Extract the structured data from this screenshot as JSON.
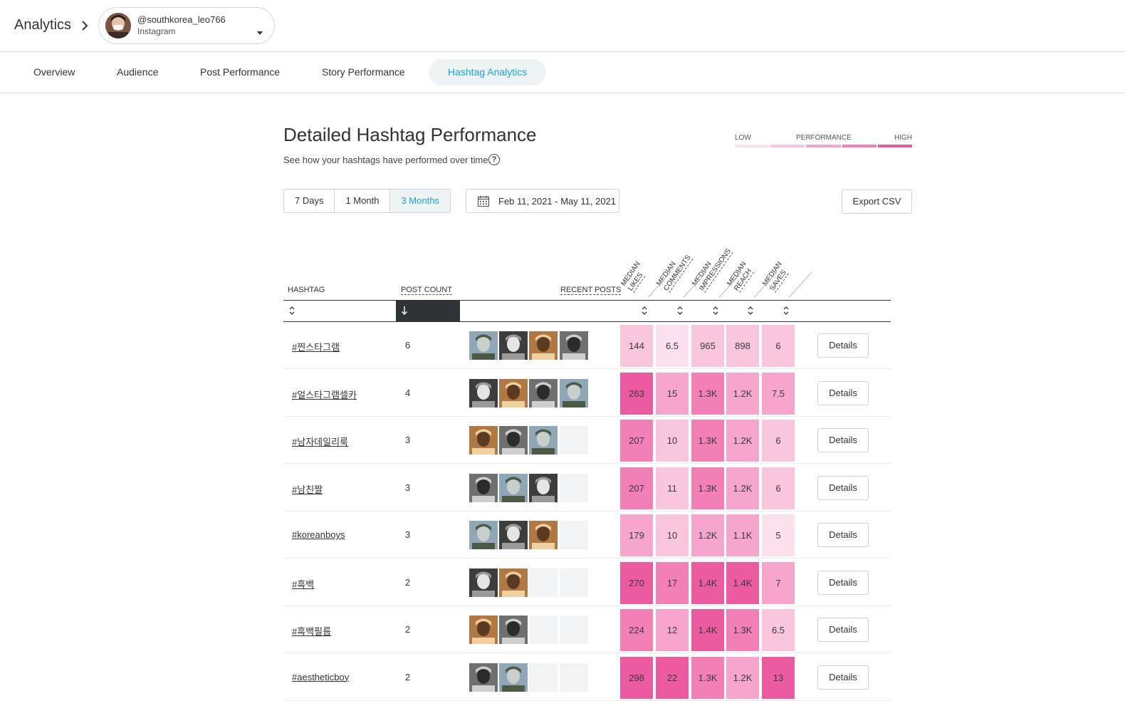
{
  "header": {
    "app_title": "Analytics",
    "account": {
      "handle": "@southkorea_leo766",
      "network": "Instagram"
    }
  },
  "tabs": [
    {
      "label": "Overview",
      "active": false
    },
    {
      "label": "Audience",
      "active": false
    },
    {
      "label": "Post Performance",
      "active": false
    },
    {
      "label": "Story Performance",
      "active": false
    },
    {
      "label": "Hashtag Analytics",
      "active": true
    }
  ],
  "section": {
    "title": "Detailed Hashtag Performance",
    "subtitle": "See how your hashtags have performed over time.",
    "help_glyph": "?"
  },
  "legend": {
    "low": "LOW",
    "mid": "PERFORMANCE",
    "high": "HIGH",
    "colors": [
      "#fbe1ee",
      "#f9c6de",
      "#f6a6cc",
      "#f27fb6",
      "#ec5a9f"
    ]
  },
  "range": {
    "options": [
      {
        "label": "7 Days",
        "active": false
      },
      {
        "label": "1 Month",
        "active": false
      },
      {
        "label": "3 Months",
        "active": true
      }
    ],
    "date_range": "Feb 11, 2021 - May 11, 2021",
    "export_label": "Export CSV"
  },
  "table": {
    "columns": {
      "hashtag": "HASHTAG",
      "post_count": "POST COUNT",
      "recent_posts": "RECENT POSTS",
      "metrics": [
        {
          "l1": "MEDIAN",
          "l2": "LIKES"
        },
        {
          "l1": "MEDIAN",
          "l2": "COMMENTS"
        },
        {
          "l1": "MEDIAN",
          "l2": "IMPRESSIONS"
        },
        {
          "l1": "MEDIAN",
          "l2": "REACH"
        },
        {
          "l1": "MEDIAN",
          "l2": "SAVES"
        }
      ]
    },
    "details_label": "Details",
    "rows": [
      {
        "hashtag": "#찐스타그램",
        "count": "6",
        "thumbs": 4,
        "metrics": [
          "144",
          "6.5",
          "965",
          "898",
          "6"
        ],
        "levels": [
          2,
          1,
          2,
          2,
          2
        ]
      },
      {
        "hashtag": "#얼스타그램셀카",
        "count": "4",
        "thumbs": 4,
        "metrics": [
          "263",
          "15",
          "1.3K",
          "1.2K",
          "7.5"
        ],
        "levels": [
          5,
          3,
          4,
          3,
          3
        ]
      },
      {
        "hashtag": "#남자데일리룩",
        "count": "3",
        "thumbs": 3,
        "metrics": [
          "207",
          "10",
          "1.3K",
          "1.2K",
          "6"
        ],
        "levels": [
          4,
          2,
          4,
          3,
          2
        ]
      },
      {
        "hashtag": "#남친짤",
        "count": "3",
        "thumbs": 3,
        "metrics": [
          "207",
          "11",
          "1.3K",
          "1.2K",
          "6"
        ],
        "levels": [
          4,
          2,
          4,
          3,
          2
        ]
      },
      {
        "hashtag": "#koreanboys",
        "count": "3",
        "thumbs": 3,
        "metrics": [
          "179",
          "10",
          "1.2K",
          "1.1K",
          "5"
        ],
        "levels": [
          3,
          2,
          3,
          3,
          1
        ]
      },
      {
        "hashtag": "#흑백",
        "count": "2",
        "thumbs": 2,
        "metrics": [
          "270",
          "17",
          "1.4K",
          "1.4K",
          "7"
        ],
        "levels": [
          5,
          4,
          5,
          5,
          3
        ]
      },
      {
        "hashtag": "#흑백필름",
        "count": "2",
        "thumbs": 2,
        "metrics": [
          "224",
          "12",
          "1.4K",
          "1.3K",
          "6.5"
        ],
        "levels": [
          4,
          3,
          5,
          4,
          2
        ]
      },
      {
        "hashtag": "#aestheticboy",
        "count": "2",
        "thumbs": 2,
        "metrics": [
          "298",
          "22",
          "1.3K",
          "1.2K",
          "13"
        ],
        "levels": [
          5,
          5,
          4,
          3,
          5
        ]
      }
    ]
  }
}
